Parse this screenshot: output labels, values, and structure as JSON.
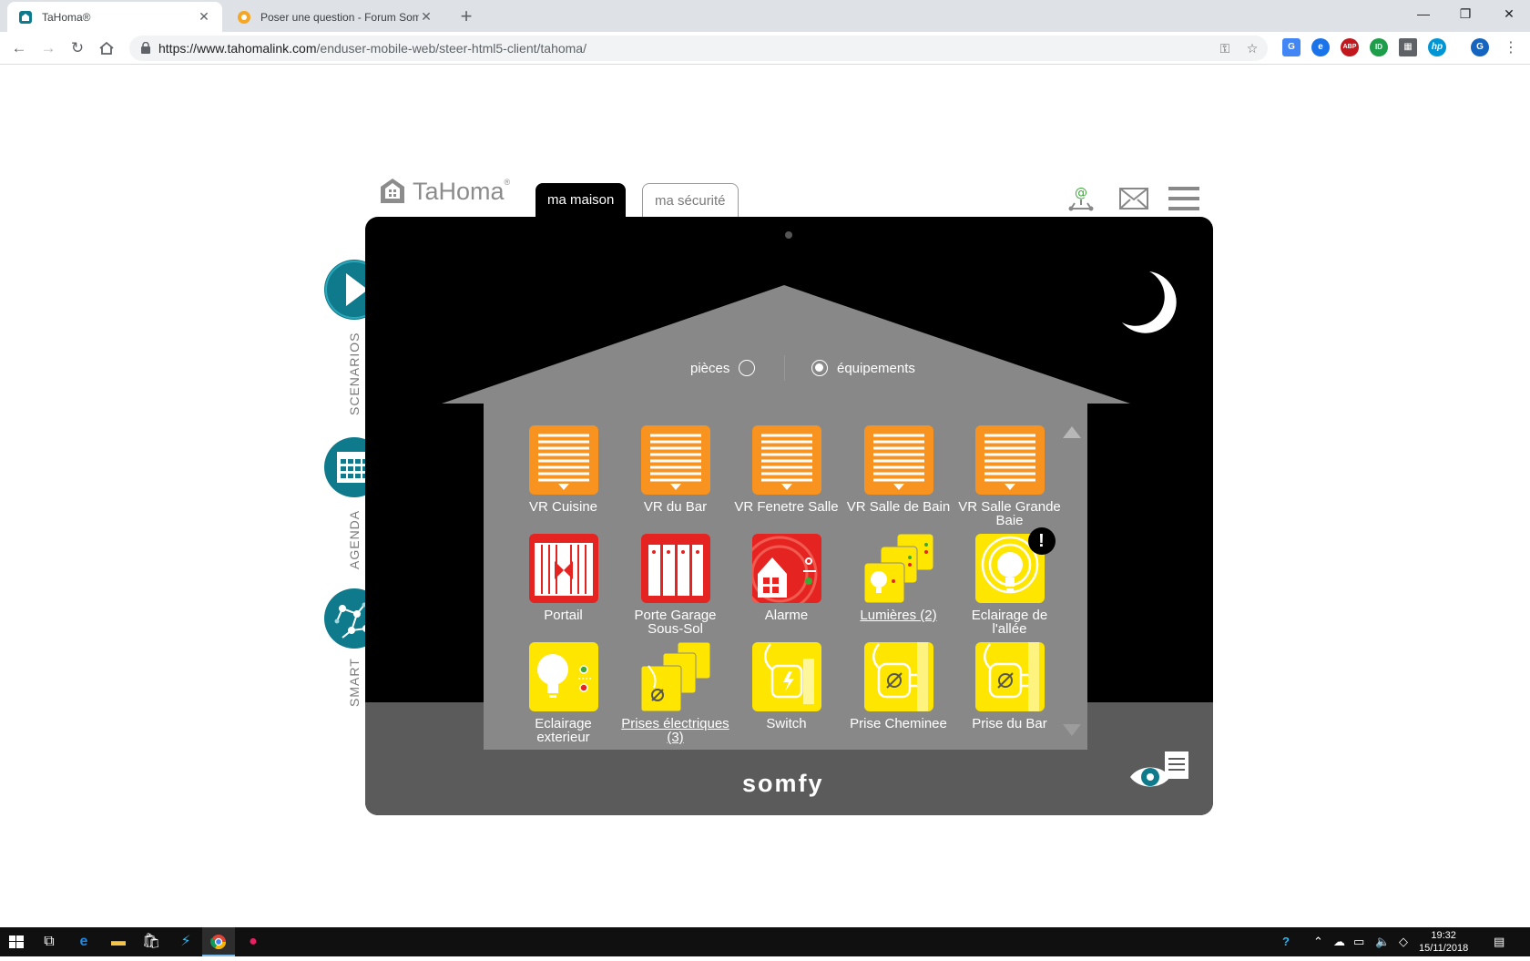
{
  "browser": {
    "tabs": [
      {
        "title": "TaHoma®",
        "active": true
      },
      {
        "title": "Poser une question - Forum Som",
        "active": false
      }
    ],
    "url_host": "https://www.tahomalink.com",
    "url_path": "/enduser-mobile-web/steer-html5-client/tahoma/",
    "window_controls": [
      "—",
      "❐",
      "✕"
    ],
    "extensions": [
      {
        "name": "translate-icon",
        "color": "#4285f4",
        "glyph": "G"
      },
      {
        "name": "e-extension-icon",
        "color": "#1a73e8",
        "glyph": "e"
      },
      {
        "name": "adblock-icon",
        "color": "#c2171d",
        "glyph": "ABP"
      },
      {
        "name": "id-extension-icon",
        "color": "#1e9e4a",
        "glyph": "ID"
      },
      {
        "name": "clapper-icon",
        "color": "#5f6368",
        "glyph": "▦"
      },
      {
        "name": "hp-icon",
        "color": "#0096d6",
        "glyph": "hp"
      },
      {
        "name": "profile-avatar",
        "color": "#1565c0",
        "glyph": "G"
      }
    ]
  },
  "app": {
    "logo_text": "TaHoma",
    "logo_mark": "®",
    "tabs": {
      "home": "ma maison",
      "security": "ma sécurité"
    },
    "view_toggle": {
      "rooms": "pièces",
      "equipment": "équipements",
      "selected": "equipment"
    },
    "side": {
      "scenarios": "SCENARIOS",
      "agenda": "AGENDA",
      "smart": "SMART"
    },
    "brand": "somfy",
    "mode": "night",
    "devices": [
      {
        "label": "VR Cuisine",
        "type": "shutter",
        "link": false
      },
      {
        "label": "VR du Bar",
        "type": "shutter",
        "link": false
      },
      {
        "label": "VR Fenetre Salle",
        "type": "shutter",
        "link": false
      },
      {
        "label": "VR Salle de Bain",
        "type": "shutter",
        "link": false
      },
      {
        "label": "VR Salle Grande Baie",
        "type": "shutter",
        "link": false
      },
      {
        "label": "Portail",
        "type": "gate",
        "link": false
      },
      {
        "label": "Porte Garage Sous-Sol",
        "type": "garage",
        "link": false
      },
      {
        "label": "Alarme",
        "type": "alarm",
        "link": false
      },
      {
        "label": "Lumières (2)",
        "type": "lights-group",
        "link": true
      },
      {
        "label": "Eclairage de l'allée",
        "type": "light-alert",
        "link": false,
        "alert": "!"
      },
      {
        "label": "Eclairage exterieur",
        "type": "light",
        "link": false
      },
      {
        "label": "Prises électriques (3)",
        "type": "plugs-group",
        "link": true
      },
      {
        "label": "Switch",
        "type": "switch",
        "link": false
      },
      {
        "label": "Prise Cheminee",
        "type": "plug",
        "link": false
      },
      {
        "label": "Prise du Bar",
        "type": "plug",
        "link": false
      }
    ],
    "colors": {
      "shutter": "#f7931e",
      "red": "#e52421",
      "yellow": "#ffe600",
      "teal": "#0e7a8c"
    }
  },
  "taskbar": {
    "time": "19:32",
    "date": "15/11/2018"
  }
}
